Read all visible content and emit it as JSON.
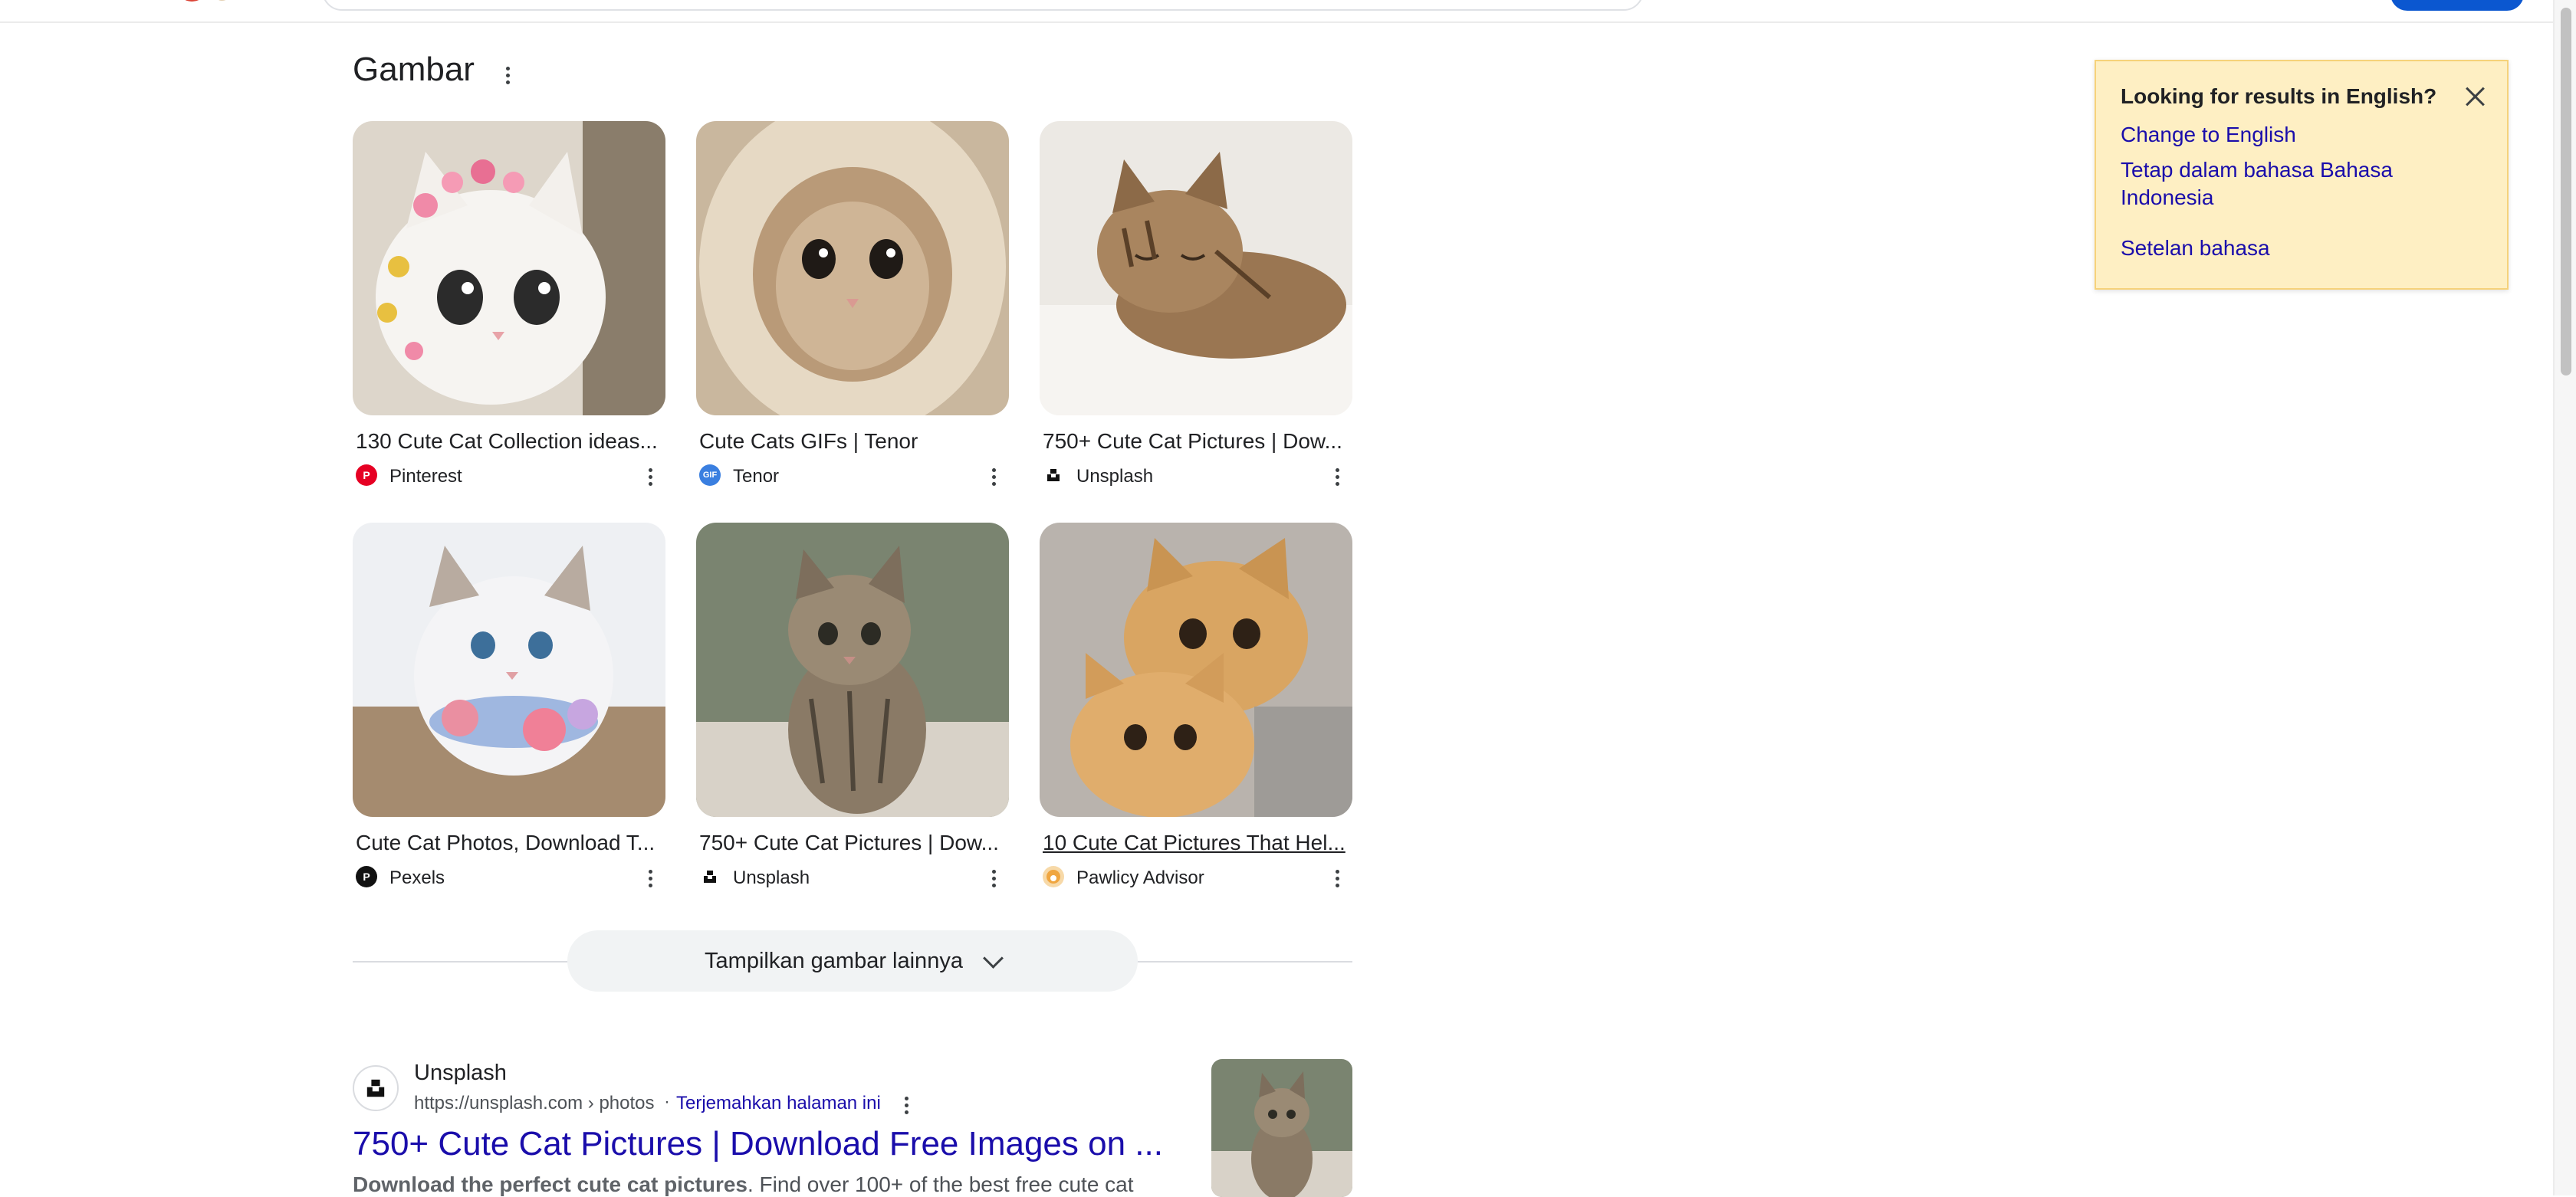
{
  "section": {
    "title": "Gambar"
  },
  "images": [
    {
      "title": "130 Cute Cat Collection ideas...",
      "source": "Pinterest",
      "icon": "pinterest-icon",
      "icon_color": "#e60023"
    },
    {
      "title": "Cute Cats GIFs | Tenor",
      "source": "Tenor",
      "icon": "tenor-icon",
      "icon_color": "#3a7fe0",
      "icon_text": "GIF"
    },
    {
      "title": "750+ Cute Cat Pictures | Dow...",
      "source": "Unsplash",
      "icon": "unsplash-icon",
      "icon_color": "#111111"
    },
    {
      "title": "Cute Cat Photos, Download T...",
      "source": "Pexels",
      "icon": "pexels-icon",
      "icon_color": "#111111"
    },
    {
      "title": "750+ Cute Cat Pictures | Dow...",
      "source": "Unsplash",
      "icon": "unsplash-icon",
      "icon_color": "#111111"
    },
    {
      "title": "10 Cute Cat Pictures That Hel...",
      "source": "Pawlicy Advisor",
      "icon": "pawlicy-icon",
      "icon_color": "#f0a640"
    }
  ],
  "more_images": {
    "label": "Tampilkan gambar lainnya"
  },
  "result": {
    "site": "Unsplash",
    "url": "https://unsplash.com › photos",
    "separator": "·",
    "translate": "Terjemahkan halaman ini",
    "title": "750+ Cute Cat Pictures | Download Free Images on ...",
    "snippet_bold": "Download the perfect cute cat pictures",
    "snippet_rest": ". Find over 100+ of the best free cute cat"
  },
  "language_prompt": {
    "title": "Looking for results in English?",
    "change": "Change to English",
    "stay": "Tetap dalam bahasa Bahasa Indonesia",
    "settings": "Setelan bahasa"
  },
  "colors": {
    "link": "#1a0dab",
    "accent": "#0b57d0",
    "prompt_bg": "#feefc3"
  }
}
